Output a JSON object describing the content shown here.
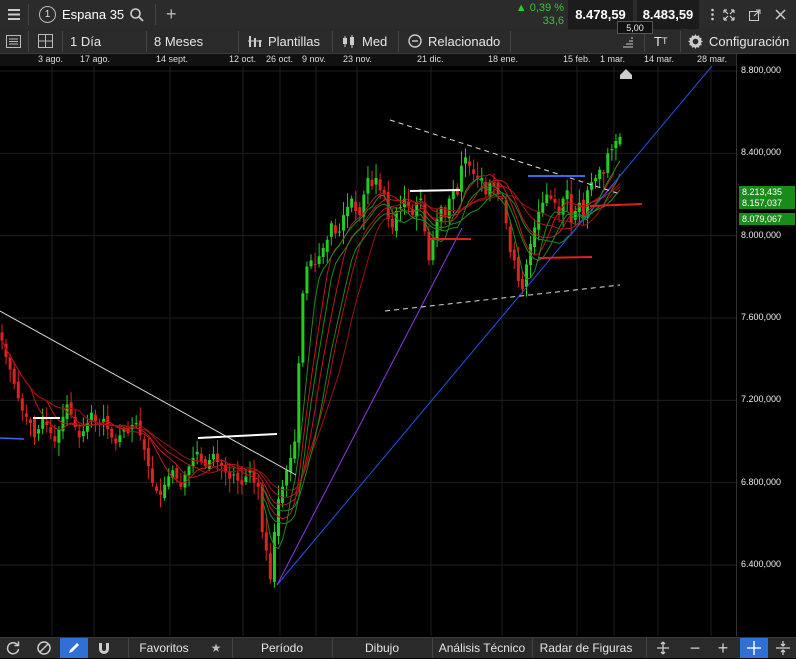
{
  "header": {
    "tab_number": "1",
    "instrument": "Espana 35",
    "change_pct": "0,39 %",
    "change_abs": "33,6",
    "bid": "8.478,59",
    "ask": "8.483,59",
    "spread": "5,00"
  },
  "toolbar": {
    "interval": "1 Día",
    "range": "8 Meses",
    "templates": "Plantillas",
    "size": "Med",
    "related": "Relacionado",
    "text_icon": "T",
    "settings": "Configuración"
  },
  "date_axis": [
    "3 ago.",
    "17 ago.",
    "14 sept.",
    "12 oct.",
    "26 oct.",
    "9 nov.",
    "23 nov.",
    "21 dic.",
    "18 ene.",
    "15 feb.",
    "1 mar.",
    "14 mar.",
    "28 mar."
  ],
  "price_axis": [
    "8.800,000",
    "8.400,000",
    "8.000,000",
    "7.600,000",
    "7.200,000",
    "6.800,000",
    "6.400,000"
  ],
  "price_badges": [
    "8.213,435",
    "8.157,037",
    "8.079,067"
  ],
  "bottom_bar": {
    "favorites": "Favoritos",
    "period": "Período",
    "drawing": "Dibujo",
    "technical": "Análisis Técnico",
    "patterns": "Radar de Figuras"
  },
  "colors": {
    "up_candle": "#22cc22",
    "down_candle": "#dd2222",
    "accent_blue": "#2f6fd6",
    "badge_green": "#1a8a1a"
  },
  "chart_data": {
    "type": "candlestick",
    "instrument": "Espana 35",
    "interval": "1 Día",
    "ylim": [
      6200,
      8900
    ],
    "y_ticks": [
      6400,
      6800,
      7200,
      7600,
      8000,
      8400,
      8800
    ],
    "x_ticks": [
      "3 ago.",
      "17 ago.",
      "14 sept.",
      "12 oct.",
      "26 oct.",
      "9 nov.",
      "23 nov.",
      "21 dic.",
      "18 ene.",
      "15 feb.",
      "1 mar.",
      "14 mar.",
      "28 mar."
    ],
    "price_labels": [
      8213.435,
      8157.037,
      8079.067
    ],
    "close": [
      7490,
      7410,
      7350,
      7280,
      7210,
      7150,
      7120,
      7090,
      7020,
      7060,
      7110,
      7080,
      7040,
      7000,
      7060,
      7120,
      7180,
      7130,
      7070,
      7020,
      7050,
      7090,
      7140,
      7100,
      7080,
      7110,
      7060,
      7020,
      6990,
      7030,
      7060,
      7040,
      7080,
      7090,
      7030,
      6960,
      6880,
      6800,
      6760,
      6740,
      6790,
      6830,
      6860,
      6820,
      6780,
      6840,
      6880,
      6920,
      6950,
      6900,
      6880,
      6910,
      6940,
      6900,
      6880,
      6850,
      6820,
      6840,
      6810,
      6790,
      6830,
      6860,
      6800,
      6780,
      6560,
      6470,
      6330,
      6560,
      6720,
      6780,
      6860,
      6920,
      7000,
      7380,
      7720,
      7850,
      7880,
      7860,
      7900,
      7940,
      7980,
      8060,
      8010,
      8020,
      8100,
      8140,
      8180,
      8120,
      8100,
      8200,
      8280,
      8240,
      8280,
      8220,
      8200,
      8080,
      8040,
      8120,
      8140,
      8180,
      8140,
      8100,
      8160,
      8180,
      8020,
      7880,
      7980,
      8080,
      8140,
      8100,
      8180,
      8220,
      8200,
      8340,
      8380,
      8340,
      8300,
      8280,
      8280,
      8200,
      8260,
      8240,
      8200,
      8180,
      8060,
      7920,
      7880,
      7780,
      7740,
      7860,
      7960,
      8040,
      8120,
      8160,
      8200,
      8180,
      8160,
      8100,
      8180,
      8220,
      8060,
      8120,
      8160,
      8080,
      8220,
      8260,
      8280,
      8320,
      8300,
      8400,
      8420,
      8460,
      8480
    ]
  }
}
